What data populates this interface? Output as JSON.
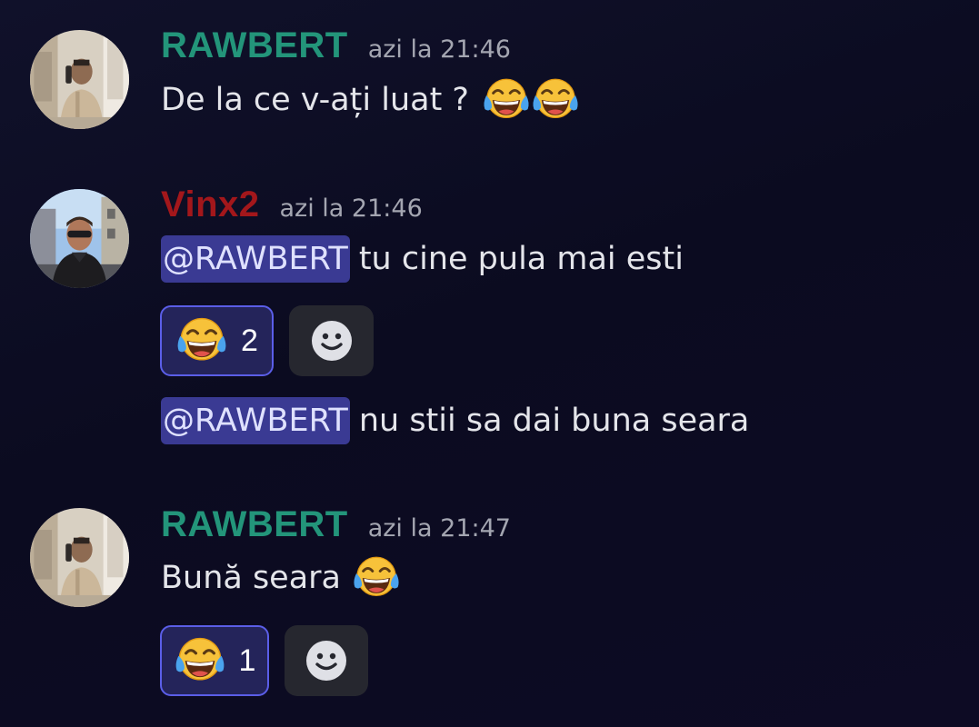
{
  "messages": [
    {
      "username": "RAWBERT",
      "username_color": "#23957a",
      "timestamp": "azi la 21:46",
      "lines": [
        {
          "text": "De la ce v-ați luat ?",
          "emoji_count": 2
        }
      ],
      "avatar": "rawbert-avatar"
    },
    {
      "username": "Vinx2",
      "username_color": "#a3171b",
      "timestamp": "azi la 21:46",
      "lines": [
        {
          "mention": "@RAWBERT",
          "text": "tu cine pula mai esti"
        },
        {
          "mention": "@RAWBERT",
          "text": "nu stii sa dai buna seara"
        }
      ],
      "reactions": [
        {
          "emoji": "joy-emoji",
          "count": "2"
        }
      ],
      "avatar": "vinx2-avatar"
    },
    {
      "username": "RAWBERT",
      "username_color": "#23957a",
      "timestamp": "azi la 21:47",
      "lines": [
        {
          "text": "Bună seara",
          "emoji_count": 1
        }
      ],
      "reactions": [
        {
          "emoji": "joy-emoji",
          "count": "1"
        }
      ],
      "avatar": "rawbert-avatar"
    }
  ],
  "colors": {
    "mention_bg": "#3a3a93",
    "reaction_bg": "#24245a",
    "reaction_border": "#5b5ee8",
    "add_reaction_bg": "#26272f",
    "timestamp": "#a4a6b1"
  },
  "icons": {
    "add_reaction": "smiley-icon",
    "reaction": "face-with-tears-of-joy"
  }
}
